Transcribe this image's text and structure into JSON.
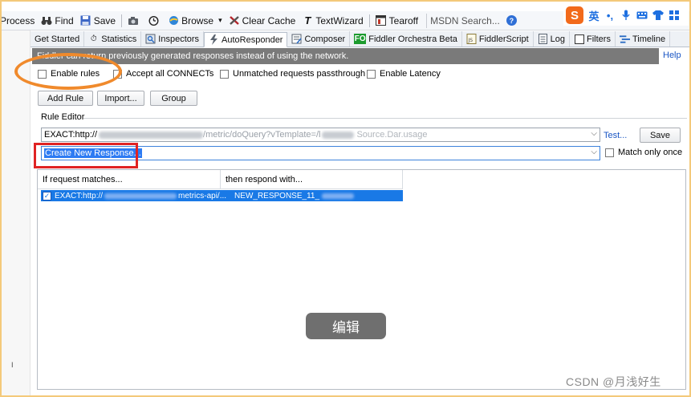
{
  "toolbar": {
    "items": [
      {
        "label": "Process",
        "icon": "process-icon"
      },
      {
        "label": "Find",
        "icon": "binoculars-icon"
      },
      {
        "label": "Save",
        "icon": "save-icon"
      },
      {
        "label": "",
        "icon": "camera-icon"
      },
      {
        "label": "",
        "icon": "timer-icon"
      },
      {
        "label": "Browse",
        "icon": "browser-icon"
      },
      {
        "label": "Clear Cache",
        "icon": "clear-cache-icon"
      },
      {
        "label": "TextWizard",
        "icon": "text-wizard-icon"
      },
      {
        "label": "Tearoff",
        "icon": "tearoff-icon"
      }
    ],
    "search_placeholder": "MSDN Search..."
  },
  "ime": {
    "logo": "S",
    "lang": "英",
    "punct": "•,",
    "items": [
      "microphone-icon",
      "keyboard-icon",
      "shirt-icon",
      "grid-icon"
    ]
  },
  "tabs": [
    {
      "label": "Get Started",
      "icon": ""
    },
    {
      "label": "Statistics",
      "icon": "stopwatch-icon"
    },
    {
      "label": "Inspectors",
      "icon": "inspectors-icon"
    },
    {
      "label": "AutoResponder",
      "icon": "lightning-icon",
      "active": true
    },
    {
      "label": "Composer",
      "icon": "composer-icon"
    },
    {
      "label": "Fiddler Orchestra Beta",
      "icon": "fo-icon"
    },
    {
      "label": "FiddlerScript",
      "icon": "script-icon"
    },
    {
      "label": "Log",
      "icon": "log-icon"
    },
    {
      "label": "Filters",
      "icon": "checkbox-icon"
    },
    {
      "label": "Timeline",
      "icon": "timeline-icon"
    }
  ],
  "infobar": {
    "text": "Fiddler can return previously generated responses instead of using the network.",
    "help": "Help"
  },
  "options": {
    "enable_rules": "Enable rules",
    "accept_connects": "Accept all CONNECTs",
    "unmatched_passthrough": "Unmatched requests passthrough",
    "enable_latency": "Enable Latency"
  },
  "buttons": {
    "add_rule": "Add Rule",
    "import": "Import...",
    "group": "Group",
    "save": "Save",
    "test": "Test..."
  },
  "rule_editor": {
    "label": "Rule Editor",
    "match_prefix": "EXACT:http://",
    "match_mid": "/metric/doQuery?vTemplate=/l",
    "match_tail": "Source.Dar.usage",
    "response_value": "Create New Response...",
    "match_only_once": "Match only once"
  },
  "list": {
    "columns": [
      "If request matches...",
      "then respond with..."
    ],
    "rows": [
      {
        "checked": true,
        "match": "EXACT:http://",
        "match_tail": "metrics-api/...",
        "response": "NEW_RESPONSE_11_"
      }
    ]
  },
  "overlay": {
    "toast": "编辑",
    "watermark": "CSDN @月浅好生"
  },
  "left_strip_mark": "I"
}
